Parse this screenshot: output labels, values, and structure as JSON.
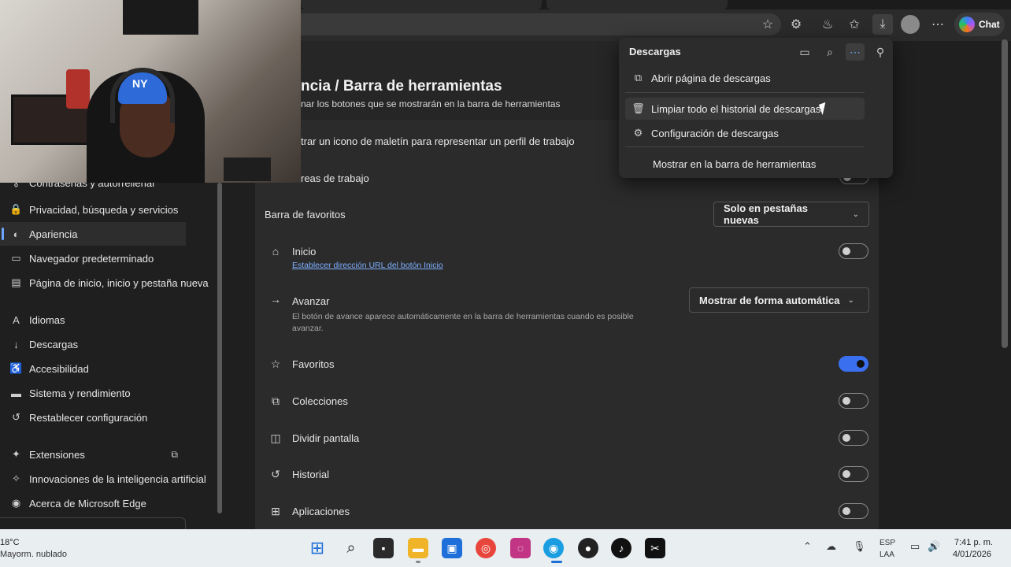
{
  "toolbar": {
    "chat_label": "Chat"
  },
  "settings": {
    "title": "ncia  /  Barra de herramientas",
    "subtitle": "nar los botones que se mostrarán en la barra de herramientas",
    "row_maletin": "trar un icono de maletín para representar un perfil de trabajo",
    "row_areas": "reas de trabajo",
    "favbar_label": "Barra de favoritos",
    "favbar_value": "Solo en pestañas nuevas",
    "inicio_label": "Inicio",
    "inicio_link": "Establecer dirección URL del botón Inicio",
    "avanzar_label": "Avanzar",
    "avanzar_desc_1": "El botón de avance aparece automáticamente en la barra de herramientas cuando es posible",
    "avanzar_desc_2": "avanzar.",
    "avanzar_value": "Mostrar de forma automática",
    "favoritos_label": "Favoritos",
    "colecciones_label": "Colecciones",
    "dividir_label": "Dividir pantalla",
    "historial_label": "Historial",
    "aplicaciones_label": "Aplicaciones",
    "toggles": {
      "inicio": false,
      "favoritos": true,
      "colecciones": false,
      "dividir": false,
      "historial": false,
      "aplicaciones": false
    }
  },
  "sidebar": {
    "items": [
      {
        "label": "Contraseñas y autorrellenar",
        "icon": "key-icon"
      },
      {
        "label": "Privacidad, búsqueda y servicios",
        "icon": "lock-icon"
      },
      {
        "label": "Apariencia",
        "icon": "palette-icon"
      },
      {
        "label": "Navegador predeterminado",
        "icon": "browser-icon"
      },
      {
        "label": "Página de inicio, inicio y pestaña nueva",
        "icon": "home-page-icon"
      },
      {
        "label": "Idiomas",
        "icon": "language-icon"
      },
      {
        "label": "Descargas",
        "icon": "download-icon"
      },
      {
        "label": "Accesibilidad",
        "icon": "accessibility-icon"
      },
      {
        "label": "Sistema y rendimiento",
        "icon": "laptop-icon"
      },
      {
        "label": "Restablecer configuración",
        "icon": "reset-icon"
      },
      {
        "label": "Extensiones",
        "icon": "extensions-icon"
      },
      {
        "label": "Innovaciones de la inteligencia artificial",
        "icon": "ai-icon"
      },
      {
        "label": "Acerca de Microsoft Edge",
        "icon": "edge-icon"
      }
    ],
    "active": "Apariencia"
  },
  "downloads": {
    "title": "Descargas",
    "items": [
      {
        "label": "Abrir página de descargas",
        "icon": "open-external-icon"
      },
      {
        "label": "Limpiar todo el historial de descargas",
        "icon": "trash-icon"
      },
      {
        "label": "Configuración de descargas",
        "icon": "gear-icon"
      },
      {
        "label": "Mostrar en la barra de herramientas",
        "icon": ""
      }
    ]
  },
  "taskbar": {
    "temp": "18°C",
    "weather": "Mayorm. nublado",
    "lang_1": "ESP",
    "lang_2": "LAA",
    "time": "7:41 p. m.",
    "date": "4/01/2026"
  },
  "colors": {
    "accent": "#3a6ff0",
    "link": "#7eb0ff",
    "background": "#1f1f1f",
    "panel": "#2b2b2b"
  }
}
